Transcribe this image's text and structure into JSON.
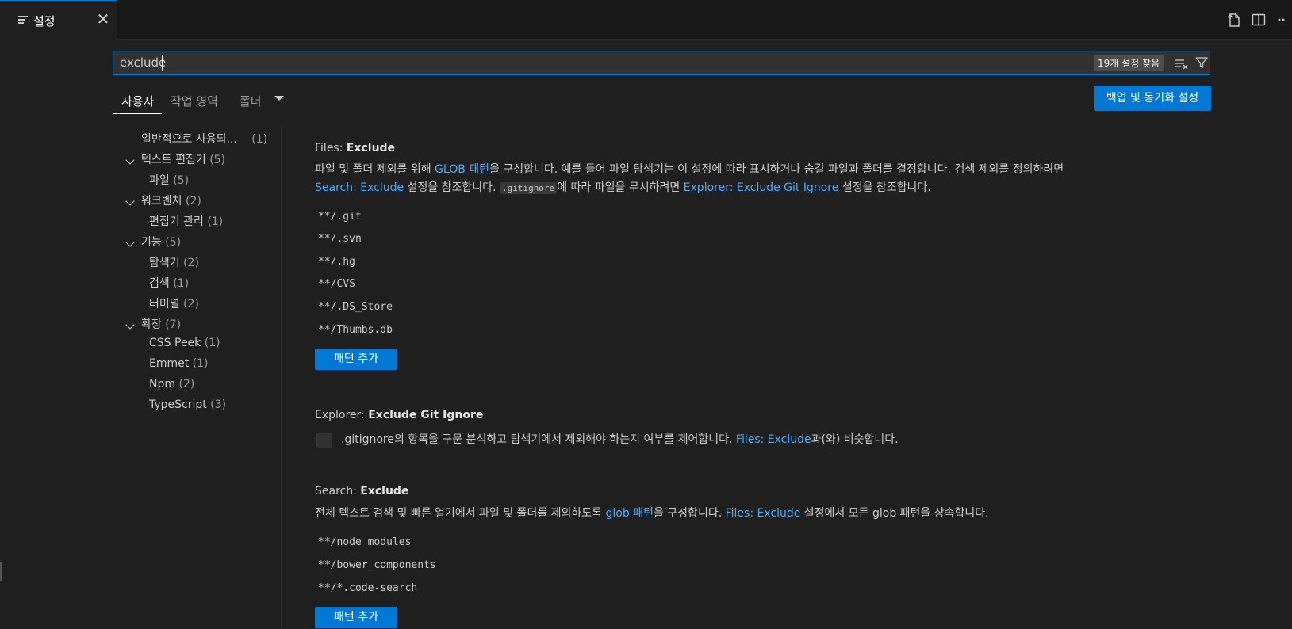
{
  "tab": {
    "label": "설정",
    "close": "✕"
  },
  "search": {
    "value": "exclude",
    "result_count": "19개 설정 찾음"
  },
  "scopes": {
    "user": "사용자",
    "workspace": "작업 영역",
    "folder": "폴더"
  },
  "sync_button": "백업 및 동기화 설정",
  "toc": {
    "common": {
      "label": "일반적으로 사용되...",
      "count": "(1)"
    },
    "text_editor": {
      "label": "텍스트 편집기",
      "count": "(5)"
    },
    "files": {
      "label": "파일",
      "count": "(5)"
    },
    "workbench": {
      "label": "워크벤치",
      "count": "(2)"
    },
    "editor_management": {
      "label": "편집기 관리",
      "count": "(1)"
    },
    "features": {
      "label": "기능",
      "count": "(5)"
    },
    "explorer": {
      "label": "탐색기",
      "count": "(2)"
    },
    "search": {
      "label": "검색",
      "count": "(1)"
    },
    "terminal": {
      "label": "터미널",
      "count": "(2)"
    },
    "extensions": {
      "label": "확장",
      "count": "(7)"
    },
    "css_peek": {
      "label": "CSS Peek",
      "count": "(1)"
    },
    "emmet": {
      "label": "Emmet",
      "count": "(1)"
    },
    "npm": {
      "label": "Npm",
      "count": "(2)"
    },
    "typescript": {
      "label": "TypeScript",
      "count": "(3)"
    }
  },
  "files_exclude": {
    "category": "Files: ",
    "name": "Exclude",
    "desc_1": "파일 및 폴더 제외를 위해 ",
    "link_glob": "GLOB 패턴",
    "desc_2": "을 구성합니다. 예를 들어 파일 탐색기는 이 설정에 따라 표시하거나 숨길 파일과 폴더를 결정합니다. 검색 제외를 정의하려면",
    "link_search_exclude": "Search: Exclude",
    "desc_3": " 설정을 참조합니다. ",
    "code_gitignore": ".gitignore",
    "desc_4": "에 따라 파일을 무시하려면 ",
    "link_explorer_git": "Explorer: Exclude Git Ignore",
    "desc_5": " 설정을 참조합니다.",
    "patterns": [
      "**/.git",
      "**/.svn",
      "**/.hg",
      "**/CVS",
      "**/.DS_Store",
      "**/Thumbs.db"
    ],
    "add_label": "패턴 추가"
  },
  "explorer_git_ignore": {
    "category": "Explorer: ",
    "name": "Exclude Git Ignore",
    "desc_1": ".gitignore의 항목을 구문 분석하고 탐색기에서 제외해야 하는지 여부를 제어합니다. ",
    "link_files_exclude": "Files: Exclude",
    "desc_2": "과(와) 비슷합니다.",
    "checked": false
  },
  "search_exclude": {
    "category": "Search: ",
    "name": "Exclude",
    "desc_1": "전체 텍스트 검색 및 빠른 열기에서 파일 및 폴더를 제외하도록 ",
    "link_glob": "glob 패턴",
    "desc_2": "을 구성합니다. ",
    "link_files_exclude": "Files: Exclude",
    "desc_3": " 설정에서 모든 glob 패턴을 상속합니다.",
    "patterns": [
      "**/node_modules",
      "**/bower_components",
      "**/*.code-search"
    ],
    "add_label": "패턴 추가"
  }
}
